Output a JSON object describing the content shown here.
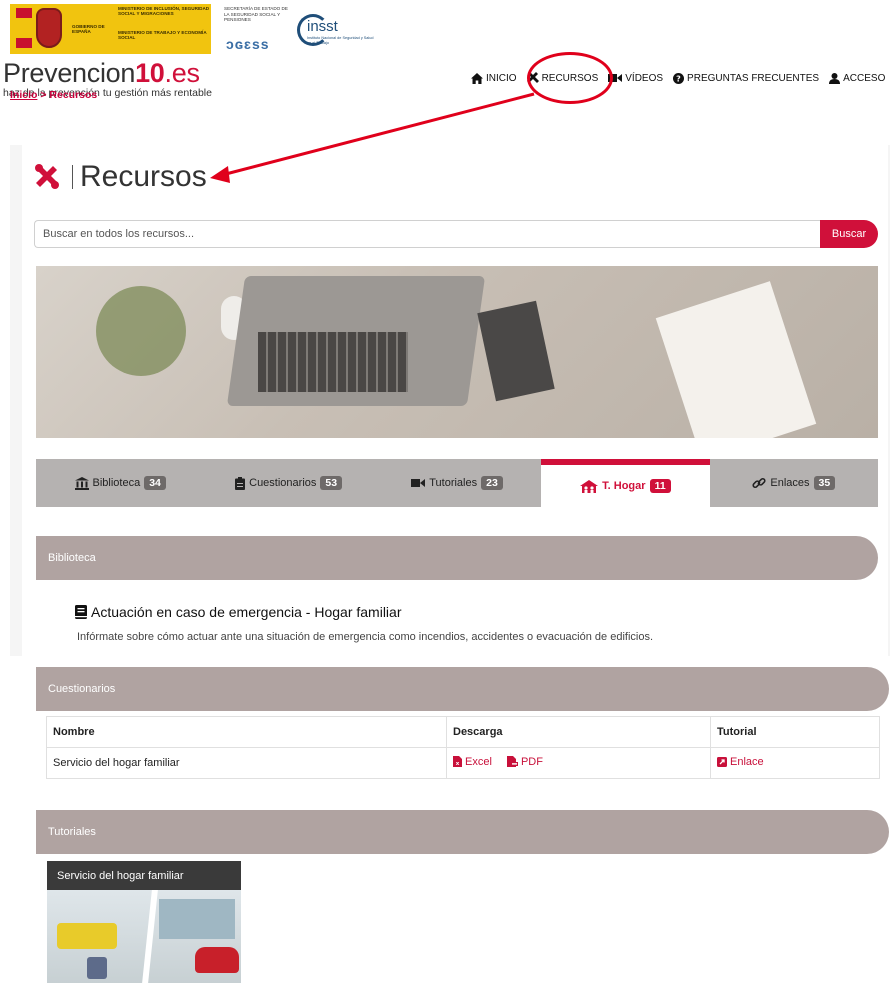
{
  "gov": {
    "gobierno": "GOBIERNO DE ESPAÑA",
    "ministerio_inclusion": "MINISTERIO DE INCLUSIÓN, SEGURIDAD SOCIAL Y MIGRACIONES",
    "ministerio_trabajo": "MINISTERIO DE TRABAJO Y ECONOMÍA SOCIAL",
    "secretaria": "SECRETARÍA DE ESTADO DE LA SEGURIDAD SOCIAL Y PENSIONES",
    "seg_social_logo": "ɔɢɛss",
    "insst_name": "insst",
    "insst_sub": "Instituto Nacional de Seguridad y Salud en el Trabajo"
  },
  "brand": {
    "name": "Prevencion",
    "number": "10",
    "tld": ".es",
    "tagline": "haz de la prevención tu gestión más rentable"
  },
  "nav": {
    "inicio": "INICIO",
    "recursos": "RECURSOS",
    "videos": "VÍDEOS",
    "faq": "PREGUNTAS FRECUENTES",
    "acceso": "ACCESO"
  },
  "breadcrumb": {
    "home": "Inicio",
    "separator": " > ",
    "current": "Recursos"
  },
  "page": {
    "title": "Recursos"
  },
  "search": {
    "placeholder": "Buscar en todos los recursos...",
    "button": "Buscar"
  },
  "tabs": [
    {
      "label": "Biblioteca",
      "count": "34"
    },
    {
      "label": "Cuestionarios",
      "count": "53"
    },
    {
      "label": "Tutoriales",
      "count": "23"
    },
    {
      "label": "T. Hogar",
      "count": "11"
    },
    {
      "label": "Enlaces",
      "count": "35"
    }
  ],
  "sections": {
    "biblioteca": {
      "title": "Biblioteca",
      "doc_title": "Actuación en caso de emergencia - Hogar familiar",
      "doc_desc": "Infórmate sobre cómo actuar ante una situación de emergencia como incendios, accidentes o evacuación de edificios."
    },
    "cuestionarios": {
      "title": "Cuestionarios",
      "columns": [
        "Nombre",
        "Descarga",
        "Tutorial"
      ],
      "row": {
        "name": "Servicio del hogar familiar",
        "excel": "Excel",
        "pdf": "PDF",
        "tutorial": "Enlace"
      }
    },
    "tutoriales": {
      "title": "Tutoriales",
      "video_title": "Servicio del hogar familiar"
    }
  },
  "colors": {
    "accent": "#d0103a",
    "section_bar": "#b0a3a1",
    "tab_bar": "#b5b2b1",
    "annotation_red": "#e0001b"
  }
}
